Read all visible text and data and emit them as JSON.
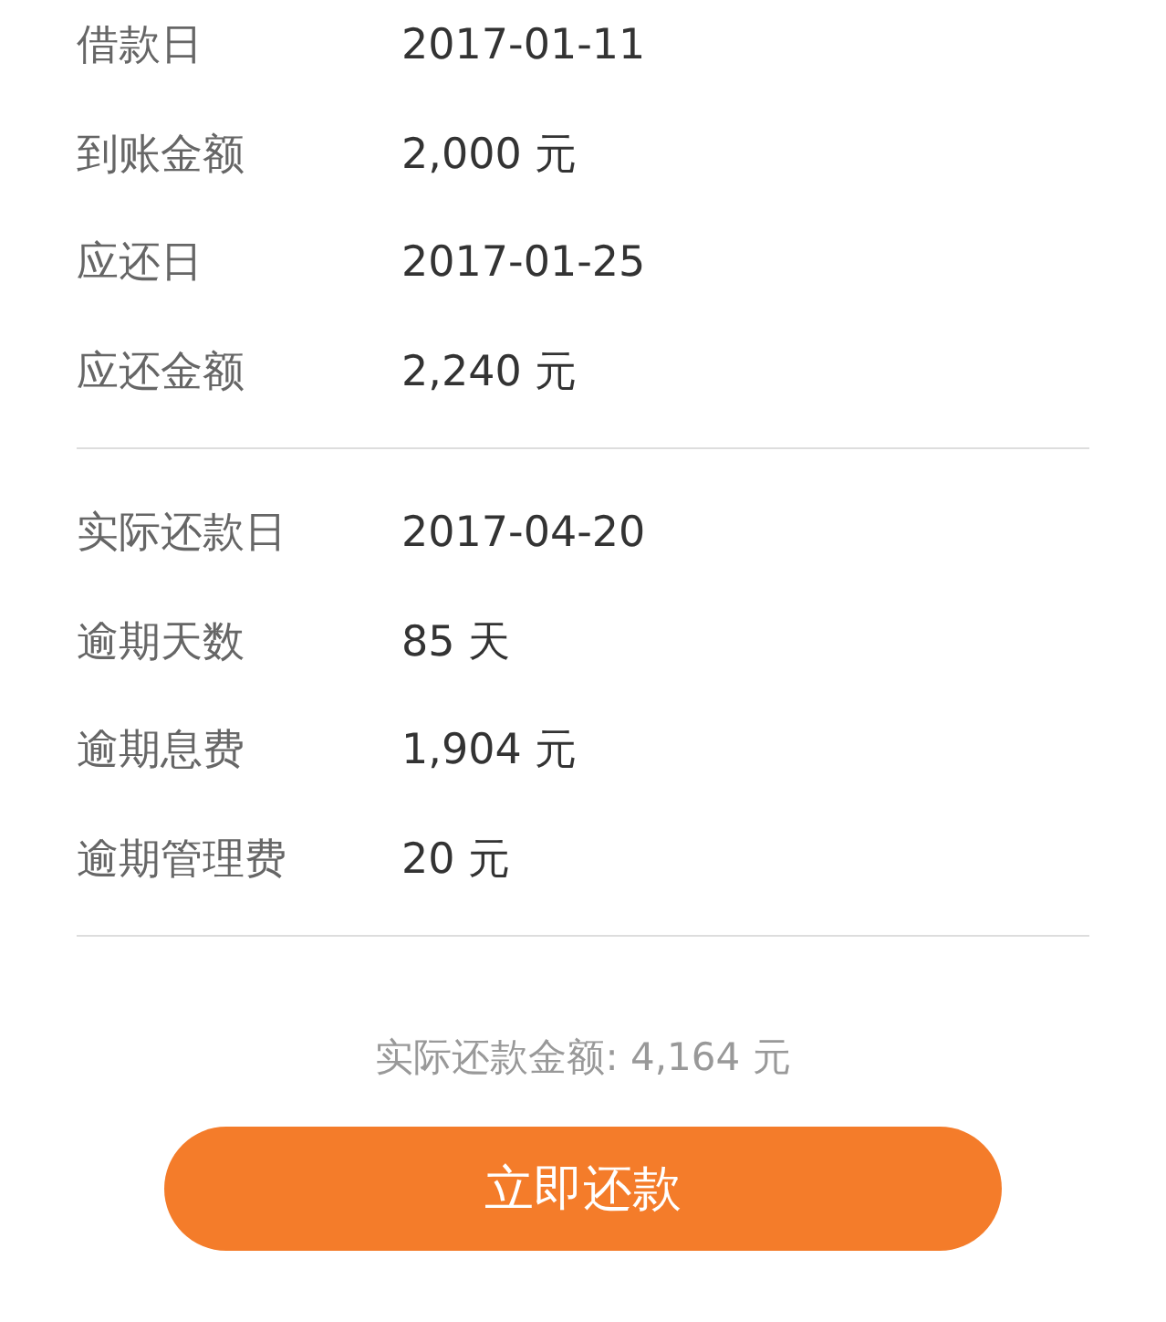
{
  "sections": [
    {
      "rows": [
        {
          "label": "借款日",
          "value": "2017-01-11"
        },
        {
          "label": "到账金额",
          "value": "2,000 元"
        },
        {
          "label": "应还日",
          "value": "2017-01-25"
        },
        {
          "label": "应还金额",
          "value": "2,240 元"
        }
      ]
    },
    {
      "rows": [
        {
          "label": "实际还款日",
          "value": "2017-04-20"
        },
        {
          "label": "逾期天数",
          "value": "85 天"
        },
        {
          "label": "逾期息费",
          "value": "1,904 元"
        },
        {
          "label": "逾期管理费",
          "value": "20 元"
        }
      ]
    }
  ],
  "total": "实际还款金额: 4,164 元",
  "button": "立即还款"
}
